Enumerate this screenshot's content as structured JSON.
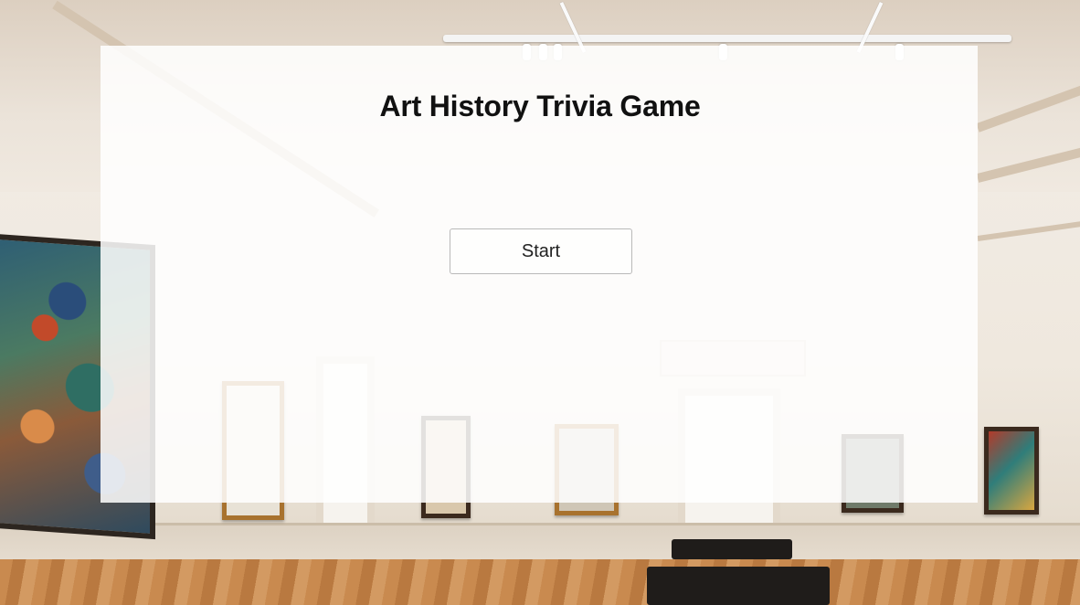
{
  "game": {
    "title": "Art History Trivia Game",
    "start_label": "Start"
  },
  "background": {
    "description_icon": "museum-gallery-image"
  },
  "colors": {
    "card_background": "#ffffff",
    "title_text": "#111111",
    "button_border": "#b9b9b9"
  }
}
